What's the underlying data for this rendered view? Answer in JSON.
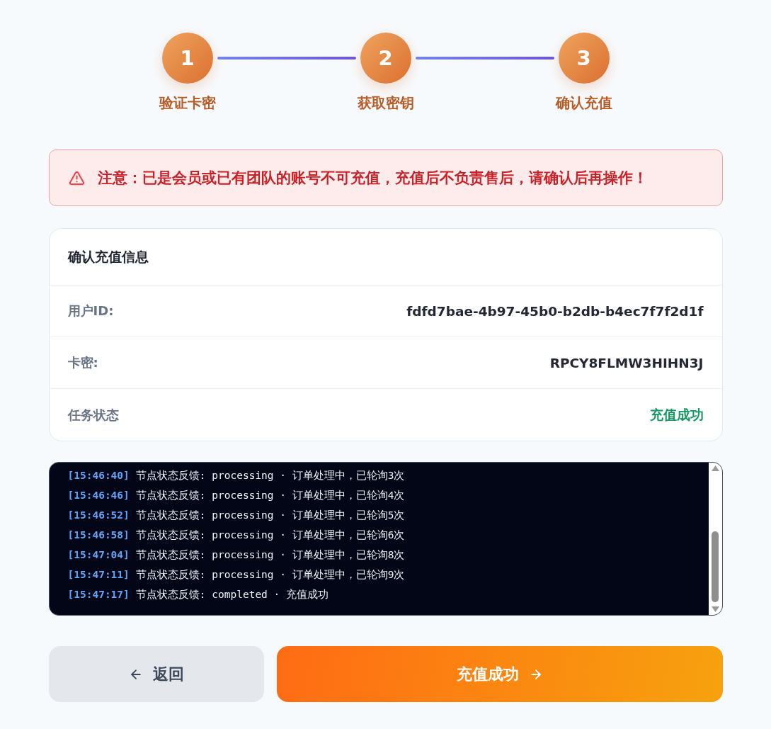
{
  "steps": [
    {
      "number": "1",
      "label": "验证卡密",
      "completed": true
    },
    {
      "number": "2",
      "label": "获取密钥",
      "completed": true
    },
    {
      "number": "3",
      "label": "确认充值",
      "completed": true
    }
  ],
  "warning": {
    "text": "注意：已是会员或已有团队的账号不可充值，充值后不负责售后，请确认后再操作！"
  },
  "confirm_card": {
    "title": "确认充值信息",
    "rows": [
      {
        "kind": "field",
        "label": "用户ID:",
        "value": "fdfd7bae-4b97-45b0-b2db-b4ec7f7f2d1f"
      },
      {
        "kind": "field",
        "label": "卡密:",
        "value": "RPCY8FLMW3HIHN3J"
      },
      {
        "kind": "status",
        "label": "任务状态",
        "value": "充值成功"
      }
    ]
  },
  "log": {
    "lines": [
      {
        "time": "[15:46:40]",
        "message": "节点状态反馈: processing · 订单处理中，已轮询3次"
      },
      {
        "time": "[15:46:46]",
        "message": "节点状态反馈: processing · 订单处理中，已轮询4次"
      },
      {
        "time": "[15:46:52]",
        "message": "节点状态反馈: processing · 订单处理中，已轮询5次"
      },
      {
        "time": "[15:46:58]",
        "message": "节点状态反馈: processing · 订单处理中，已轮询6次"
      },
      {
        "time": "[15:47:04]",
        "message": "节点状态反馈: processing · 订单处理中，已轮询8次"
      },
      {
        "time": "[15:47:11]",
        "message": "节点状态反馈: processing · 订单处理中，已轮询9次"
      },
      {
        "time": "[15:47:17]",
        "message": "节点状态反馈: completed · 充值成功"
      }
    ]
  },
  "buttons": [
    {
      "kind": "back",
      "label": "返回"
    },
    {
      "kind": "primary",
      "label": "充值成功"
    }
  ]
}
